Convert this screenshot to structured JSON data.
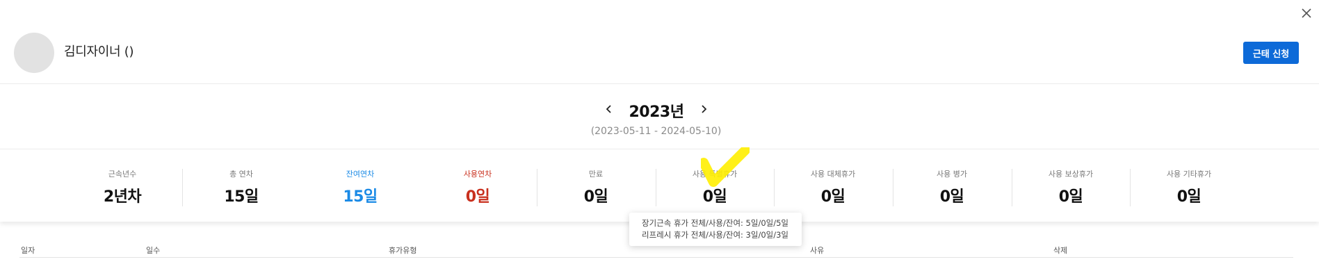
{
  "modal": {
    "close_icon": "close-icon"
  },
  "profile": {
    "name": "김디자이너 ()",
    "apply_button": "근태 신청"
  },
  "year": {
    "title": "2023년",
    "range": "(2023-05-11 - 2024-05-10)"
  },
  "stats": [
    {
      "label": "근속년수",
      "value": "2년차"
    },
    {
      "label": "총 연차",
      "value": "15일"
    },
    {
      "label": "잔여연차",
      "value": "15일",
      "color": "#1a8ae6"
    },
    {
      "label": "사용연차",
      "value": "0일",
      "color": "#c9301e"
    },
    {
      "label": "만료",
      "value": "0일"
    },
    {
      "label": "사용 특별휴가",
      "value": "0일"
    },
    {
      "label": "사용 대체휴가",
      "value": "0일"
    },
    {
      "label": "사용 병가",
      "value": "0일"
    },
    {
      "label": "사용 보상휴가",
      "value": "0일"
    },
    {
      "label": "사용 기타휴가",
      "value": "0일"
    }
  ],
  "tooltip": {
    "lines": [
      "장기근속 휴가 전체/사용/잔여: 5일/0일/5일",
      "리프레시 휴가 전체/사용/잔여: 3일/0일/3일"
    ]
  },
  "table": {
    "headers": [
      "일자",
      "일수",
      "휴가유형",
      "사유",
      "삭제"
    ]
  },
  "colors": {
    "accent": "#0d6ad8",
    "remaining": "#1a8ae6",
    "used": "#c9301e",
    "highlight": "#ffee00"
  }
}
